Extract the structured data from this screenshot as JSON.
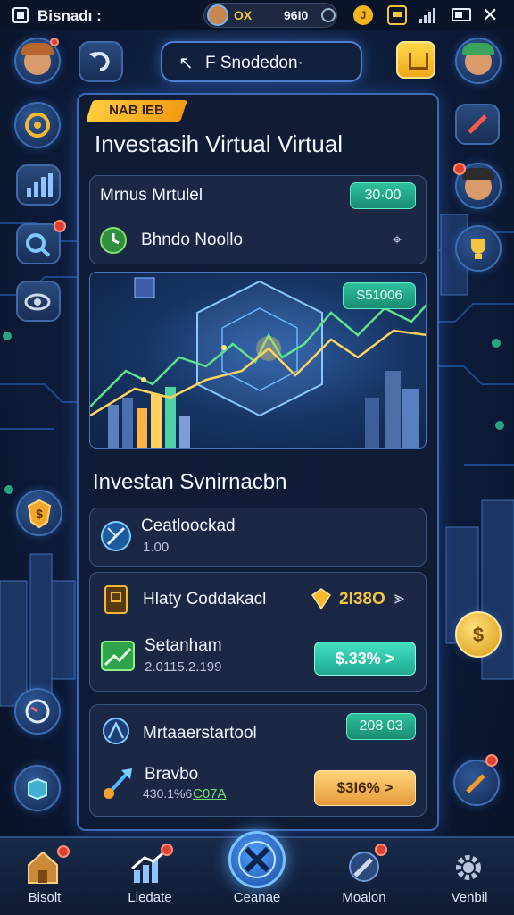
{
  "status_bar": {
    "app_title": "Bisnadı :",
    "profile_code": "OX",
    "balance": "96I0",
    "coin_symbol": "J"
  },
  "header": {
    "title": "F Snodedon·",
    "title_icon": "cursor-icon"
  },
  "panel": {
    "ribbon": "NAB IEB",
    "title": "Investasih Virtual Virtual",
    "card1": {
      "heading": "Mrnus Mrtulel",
      "value": "30·00",
      "subtitle": "Bhndo Noollo",
      "pin_icon": "pin-icon"
    },
    "chart_card": {
      "value_label": "S51006"
    },
    "section_title": "Investan Svnirnacbn",
    "list": [
      {
        "title": "Ceatloockad",
        "sub": "1.00",
        "icon": "compass-icon"
      },
      {
        "title": "Hlaty Coddakacl",
        "value": "2I38O",
        "icon": "book-icon"
      },
      {
        "title": "Setanham",
        "sub": "2.0115.2.199",
        "button": "$.33% >",
        "icon": "growth-chart-icon"
      },
      {
        "title": "Mrtaaerstartool",
        "badge": "208 03",
        "icon": "compass-icon"
      },
      {
        "title": "Bravbo",
        "sub1": "430.1%6",
        "sub2": "C07A",
        "button": "$3I6% >",
        "icon": "rocket-icon"
      }
    ]
  },
  "bottom_nav": [
    {
      "label": "Bisolt",
      "icon": "house-icon",
      "badge": true
    },
    {
      "label": "Liedate",
      "icon": "growth-chart-icon",
      "badge": true
    },
    {
      "label": "Ceanae",
      "icon": "tools-icon",
      "badge": false
    },
    {
      "label": "Moalon",
      "icon": "wrench-icon",
      "badge": true
    },
    {
      "label": "Venbil",
      "icon": "gear-icon",
      "badge": false
    }
  ],
  "colors": {
    "background": "#0d1c3a",
    "panel_border": "#3d6ab0",
    "accent_gold": "#f5c542",
    "accent_teal": "#2ec09b",
    "accent_orange": "#e79a3b"
  }
}
